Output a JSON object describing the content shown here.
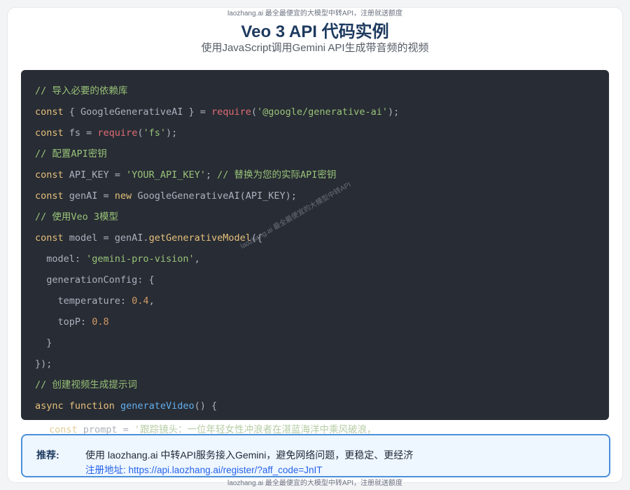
{
  "watermark": {
    "text": "laozhang.ai 最全最便宜的大模型中转API，注册就送额度",
    "diagonal": "laozhang.ai 最全最便宜的大模型中转API"
  },
  "header": {
    "title": "Veo 3 API 代码实例",
    "subtitle": "使用JavaScript调用Gemini API生成带音频的视频"
  },
  "code": {
    "l1": "// 导入必要的依赖库",
    "l2": {
      "kw": "const",
      "a": " { GoogleGenerativeAI } = ",
      "fn": "require",
      "p": "(",
      "str": "'@google/generative-ai'",
      "end": ");"
    },
    "l3": {
      "kw": "const",
      "a": " fs = ",
      "fn": "require",
      "p": "(",
      "str": "'fs'",
      "end": ");"
    },
    "l4": "// 配置API密钥",
    "l5": {
      "kw": "const",
      "a": " API_KEY = ",
      "str": "'YOUR_API_KEY'",
      "b": "; ",
      "cm": "// 替换为您的实际API密钥"
    },
    "l6": {
      "kw": "const",
      "a": " genAI = ",
      "kw2": "new",
      "b": " GoogleGenerativeAI(API_KEY);"
    },
    "l7": "// 使用Veo 3模型",
    "l8": {
      "kw": "const",
      "a": " model = genAI.",
      "meth": "getGenerativeModel",
      "b": "({"
    },
    "l9": {
      "a": "  model: ",
      "str": "'gemini-pro-vision'",
      "b": ","
    },
    "l10": "  generationConfig: {",
    "l11": {
      "a": "    temperature: ",
      "num": "0.4",
      "b": ","
    },
    "l12": {
      "a": "    topP: ",
      "num": "0.8"
    },
    "l13": "  }",
    "l14": "});",
    "l15": "// 创建视频生成提示词",
    "l16": {
      "kw": "async",
      "a": " ",
      "kw2": "function",
      "b": " ",
      "call": "generateVideo",
      "c": "() {"
    },
    "l17": {
      "kw": "const",
      "a": " prompt = ",
      "str": "'跟踪镜头：一位年轻女性冲浪者在湛蓝海洋中乘风破浪，"
    }
  },
  "recommend": {
    "label": "推荐:",
    "text": "使用 laozhang.ai 中转API服务接入Gemini，避免网络问题，更稳定、更经济",
    "link": "注册地址: https://api.laozhang.ai/register/?aff_code=JnIT"
  }
}
